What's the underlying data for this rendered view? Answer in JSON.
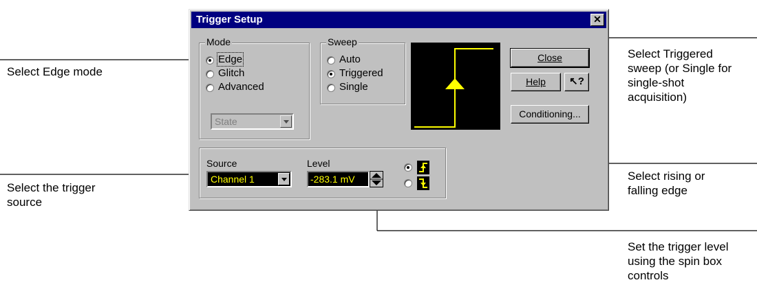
{
  "callouts": {
    "edge_mode": "Select Edge mode",
    "trigger_source_line1": "Select the trigger",
    "trigger_source_line2": "source",
    "sweep_line1": "Select Triggered",
    "sweep_line2": "sweep (or Single for",
    "sweep_line3": "single-shot",
    "sweep_line4": "acquisition)",
    "edge_line1": "Select rising or",
    "edge_line2": "falling edge",
    "level_line1": "Set the trigger level",
    "level_line2": "using the spin box",
    "level_line3": "controls"
  },
  "dialog": {
    "title": "Trigger Setup",
    "close_glyph": "✕",
    "mode": {
      "legend": "Mode",
      "options": [
        "Edge",
        "Glitch",
        "Advanced"
      ],
      "selected": "Edge",
      "state_value": "State"
    },
    "sweep": {
      "legend": "Sweep",
      "options": [
        "Auto",
        "Triggered",
        "Single"
      ],
      "selected": "Triggered"
    },
    "buttons": {
      "close": "Close",
      "help": "Help",
      "help_pointer": "↖?",
      "conditioning": "Conditioning..."
    },
    "source": {
      "label": "Source",
      "value": "Channel 1"
    },
    "level": {
      "label": "Level",
      "value": "-283.1 mV"
    },
    "edge": {
      "selected": "rising"
    }
  },
  "colors": {
    "dialog_face": "#c0c0c0",
    "titlebar": "#000080",
    "preview_bg": "#000000",
    "trace": "#ffff00",
    "field_bg": "#000000",
    "field_text": "#ffff00"
  }
}
